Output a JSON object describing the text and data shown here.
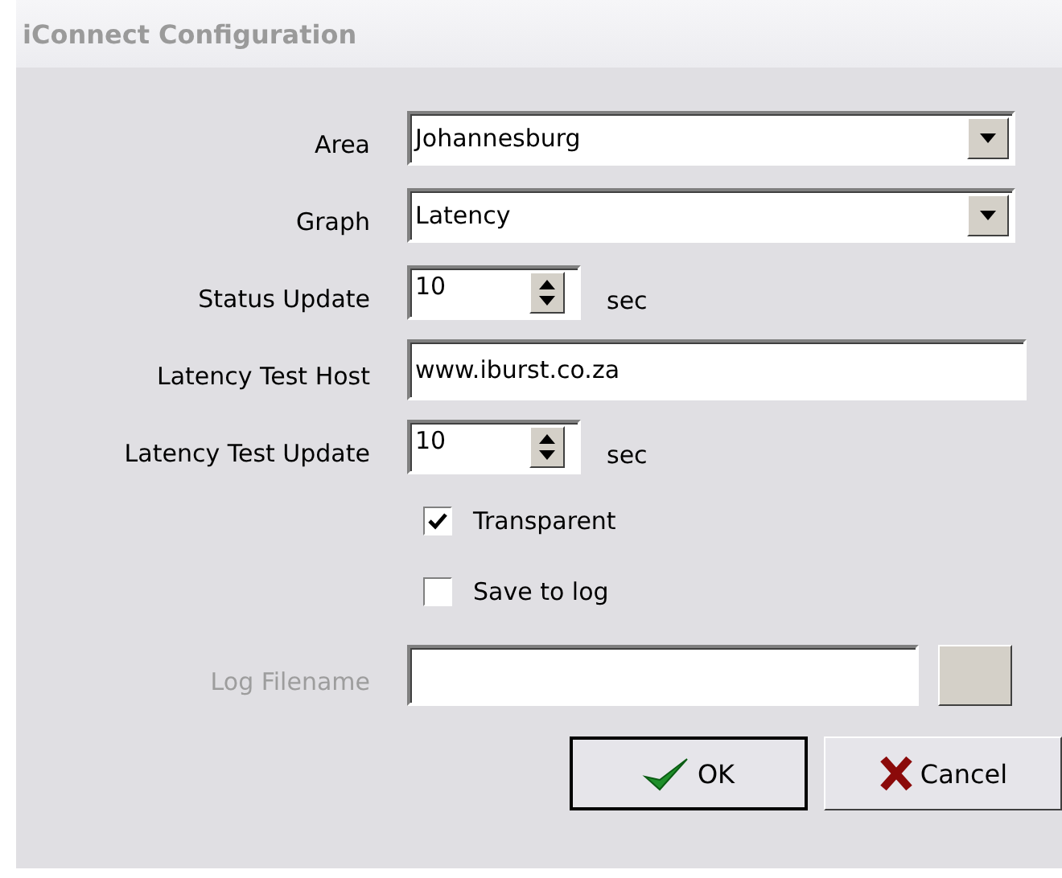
{
  "window": {
    "title": "iConnect Configuration"
  },
  "fields": [
    {
      "kind": "combo",
      "label": "Area",
      "value": "Johannesburg",
      "disabled": false
    },
    {
      "kind": "combo",
      "label": "Graph",
      "value": "Latency",
      "disabled": false
    },
    {
      "kind": "spin",
      "label": "Status Update",
      "value": "10",
      "unit": "sec",
      "disabled": false
    },
    {
      "kind": "text",
      "label": "Latency Test Host",
      "value": "www.iburst.co.za",
      "disabled": false
    },
    {
      "kind": "spin",
      "label": "Latency Test Update",
      "value": "10",
      "unit": "sec",
      "disabled": false
    }
  ],
  "checkboxes": [
    {
      "label": "Transparent",
      "checked": true
    },
    {
      "label": "Save to log",
      "checked": false
    }
  ],
  "log_field": {
    "kind": "file",
    "label": "Log Filename",
    "disabled": true
  },
  "buttons": [
    {
      "kind": "ok",
      "label": "OK",
      "default": true
    },
    {
      "kind": "cancel",
      "label": "Cancel",
      "default": false
    }
  ]
}
